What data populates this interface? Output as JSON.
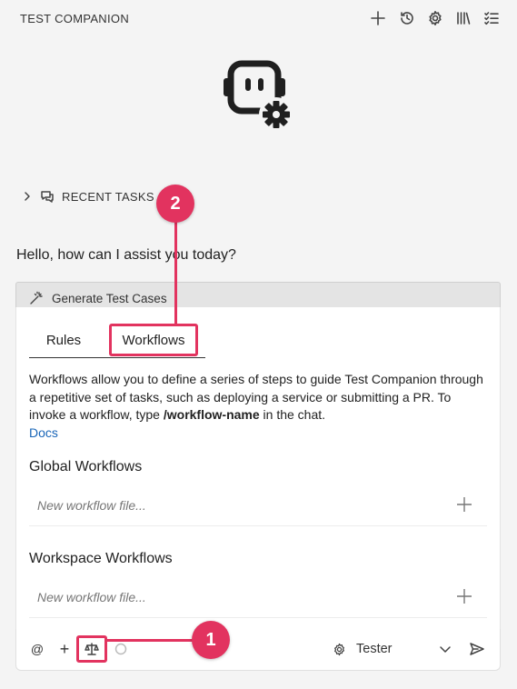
{
  "header": {
    "title": "TEST COMPANION",
    "icons": [
      "plus-icon",
      "history-icon",
      "gear-icon",
      "library-icon",
      "checklist-icon"
    ]
  },
  "logo": {
    "icon": "robot-gear-icon"
  },
  "recent_tasks": {
    "label": "RECENT TASKS"
  },
  "greeting": "Hello, how can I assist you today?",
  "generate": {
    "label": "Generate Test Cases"
  },
  "tabs": [
    {
      "label": "Rules",
      "active": false
    },
    {
      "label": "Workflows",
      "active": true
    }
  ],
  "description": {
    "pre": "Workflows allow you to define a series of steps to guide Test Companion through a repetitive set of tasks, such as deploying a service or submitting a PR. To invoke a workflow, type ",
    "bold": "/workflow-name",
    "post": " in the chat.",
    "link": "Docs"
  },
  "global": {
    "title": "Global Workflows",
    "placeholder": "New workflow file..."
  },
  "workspace": {
    "title": "Workspace Workflows",
    "placeholder": "New workflow file..."
  },
  "input_bar": {
    "at": "@",
    "plus": "+",
    "mode": "Tester"
  },
  "annotations": {
    "one": "1",
    "two": "2"
  },
  "colors": {
    "accent": "#e2335f",
    "link": "#1a66b8"
  }
}
